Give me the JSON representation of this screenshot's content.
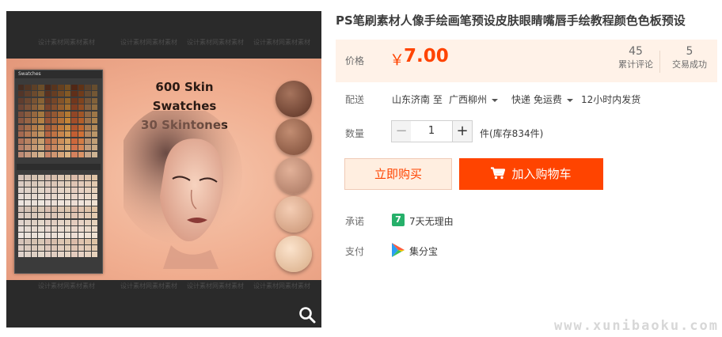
{
  "product_image": {
    "watermark_text": "设计素材网素材素材",
    "canvas_title_line1": "600 Skin Swatches",
    "canvas_title_line2": "30 Skintones",
    "panel_title": "Swatches"
  },
  "product": {
    "title": "PS笔刷素材人像手绘画笔预设皮肤眼睛嘴唇手绘教程颜色色板预设"
  },
  "price": {
    "label": "价格",
    "currency": "￥",
    "value": "7.00",
    "reviews_count": "45",
    "reviews_label": "累计评论",
    "sales_count": "5",
    "sales_label": "交易成功"
  },
  "delivery": {
    "label": "配送",
    "origin": "山东济南 至",
    "destination": "广西柳州",
    "shipping": "快递 免运费",
    "dispatch": "12小时内发货"
  },
  "quantity": {
    "label": "数量",
    "value": "1",
    "minus": "−",
    "plus": "+",
    "stock": "件(库存834件)"
  },
  "actions": {
    "buy_now": "立即购买",
    "add_to_cart": "加入购物车"
  },
  "promise": {
    "label": "承诺",
    "badge": "7",
    "text": "7天无理由"
  },
  "payment": {
    "label": "支付",
    "method": "集分宝"
  },
  "site_watermark": "www.xunibaoku.com",
  "colors": {
    "accent": "#ff4400",
    "price_bg": "#fff2e8",
    "buy_now_bg": "#ffeee0",
    "promise_green": "#26b06a"
  }
}
